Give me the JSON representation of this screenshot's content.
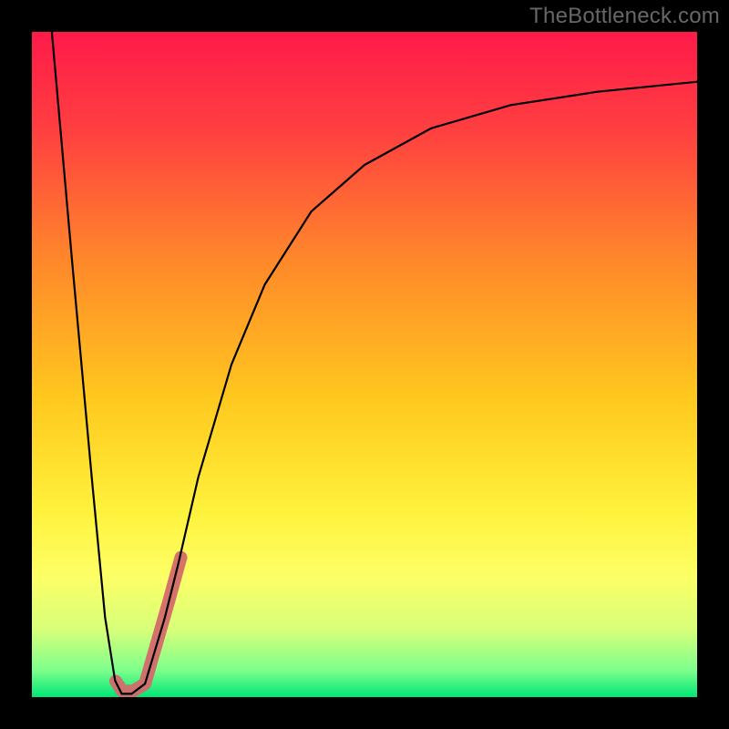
{
  "watermark": {
    "text": "TheBottleneck.com"
  },
  "chart_data": {
    "type": "line",
    "title": "",
    "xlabel": "",
    "ylabel": "",
    "xlim": [
      0,
      100
    ],
    "ylim": [
      0,
      100
    ],
    "grid": false,
    "gradient": {
      "stops": [
        {
          "offset": 0.0,
          "color": "#ff1a4a"
        },
        {
          "offset": 0.15,
          "color": "#ff4040"
        },
        {
          "offset": 0.35,
          "color": "#ff8a2a"
        },
        {
          "offset": 0.55,
          "color": "#ffc81e"
        },
        {
          "offset": 0.72,
          "color": "#fff23c"
        },
        {
          "offset": 0.82,
          "color": "#fdff66"
        },
        {
          "offset": 0.9,
          "color": "#d6ff7a"
        },
        {
          "offset": 0.96,
          "color": "#7dff8c"
        },
        {
          "offset": 1.0,
          "color": "#00e676"
        }
      ]
    },
    "series": [
      {
        "name": "main-curve",
        "color": "#000000",
        "width": 2.2,
        "points": [
          {
            "x": 3.0,
            "y": 100.0
          },
          {
            "x": 6.0,
            "y": 66.0
          },
          {
            "x": 9.0,
            "y": 33.0
          },
          {
            "x": 11.0,
            "y": 12.0
          },
          {
            "x": 12.5,
            "y": 2.5
          },
          {
            "x": 13.5,
            "y": 0.5
          },
          {
            "x": 15.0,
            "y": 0.5
          },
          {
            "x": 17.0,
            "y": 2.0
          },
          {
            "x": 20.0,
            "y": 12.0
          },
          {
            "x": 22.0,
            "y": 20.0
          },
          {
            "x": 25.0,
            "y": 33.0
          },
          {
            "x": 30.0,
            "y": 50.0
          },
          {
            "x": 35.0,
            "y": 62.0
          },
          {
            "x": 42.0,
            "y": 73.0
          },
          {
            "x": 50.0,
            "y": 80.0
          },
          {
            "x": 60.0,
            "y": 85.5
          },
          {
            "x": 72.0,
            "y": 89.0
          },
          {
            "x": 85.0,
            "y": 91.0
          },
          {
            "x": 100.0,
            "y": 92.5
          }
        ]
      },
      {
        "name": "highlight-segment",
        "color": "#d36a6a",
        "width": 14,
        "cap": "round",
        "points": [
          {
            "x": 12.6,
            "y": 2.4
          },
          {
            "x": 13.6,
            "y": 0.9
          },
          {
            "x": 15.2,
            "y": 0.9
          },
          {
            "x": 17.0,
            "y": 2.0
          },
          {
            "x": 20.6,
            "y": 14.5
          },
          {
            "x": 22.4,
            "y": 21.0
          }
        ]
      }
    ]
  }
}
